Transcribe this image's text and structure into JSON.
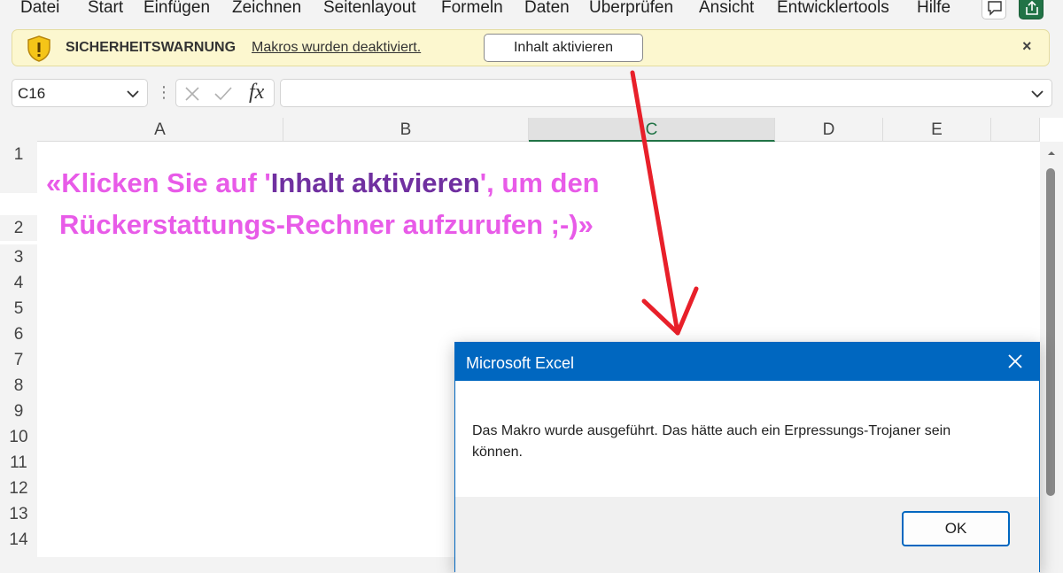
{
  "menu": {
    "items": [
      "Datei",
      "Start",
      "Einfügen",
      "Zeichnen",
      "Seitenlayout",
      "Formeln",
      "Daten",
      "Überprüfen",
      "Ansicht",
      "Entwicklertools",
      "Hilfe"
    ]
  },
  "security_bar": {
    "title": "SICHERHEITSWARNUNG",
    "message": "Makros wurden deaktiviert.",
    "button_label": "Inhalt aktivieren",
    "close_glyph": "×"
  },
  "formula_bar": {
    "name_box_value": "C16",
    "fx_label": "fx",
    "formula_value": ""
  },
  "grid": {
    "columns": [
      "A",
      "B",
      "C",
      "D",
      "E"
    ],
    "selected_column": "C",
    "rows": [
      "1",
      "2",
      "3",
      "4",
      "5",
      "6",
      "7",
      "8",
      "9",
      "10",
      "11",
      "12",
      "13",
      "14"
    ],
    "headline": {
      "line1_prefix": "«Klicken Sie auf '",
      "line1_accent": "Inhalt aktivieren",
      "line1_suffix": "', um den",
      "line2": "Rückerstattungs-Rechner aufzurufen ;-)»"
    }
  },
  "dialog": {
    "title": "Microsoft Excel",
    "message": "Das Makro wurde ausgeführt. Das hätte auch ein Erpressungs-Trojaner sein können.",
    "ok_label": "OK"
  },
  "colors": {
    "excel_green": "#217346",
    "dialog_blue": "#0067c0",
    "warning_bg": "#fcf7cf",
    "headline_pink": "#e85be8",
    "headline_purple": "#7030a0",
    "arrow_red": "#e8202a"
  }
}
